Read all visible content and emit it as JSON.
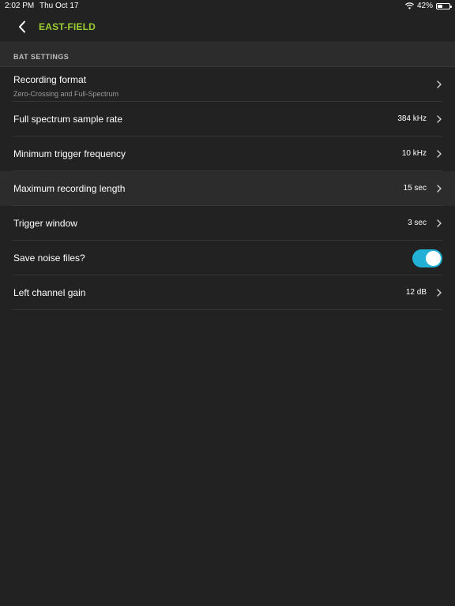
{
  "status_bar": {
    "time": "2:02 PM",
    "date": "Thu Oct 17",
    "battery_percent_label": "42%",
    "battery_level": 0.42,
    "wifi_icon": "wifi-icon",
    "battery_icon": "battery-icon"
  },
  "nav": {
    "title": "EAST-FIELD",
    "back_icon": "chevron-left-icon",
    "title_color": "#9acd32"
  },
  "section": {
    "header": "BAT SETTINGS"
  },
  "settings": [
    {
      "label": "Recording format",
      "sublabel": "Zero-Crossing and Full-Spectrum",
      "value": ""
    },
    {
      "label": "Full spectrum sample rate",
      "value": "384 kHz"
    },
    {
      "label": "Minimum trigger frequency",
      "value": "10 kHz"
    },
    {
      "label": "Maximum recording length",
      "value": "15 sec"
    },
    {
      "label": "Trigger window",
      "value": "3 sec"
    },
    {
      "label": "Save noise files?",
      "toggle_on": true
    },
    {
      "label": "Left channel gain",
      "value": "12 dB"
    }
  ],
  "colors": {
    "background": "#222222",
    "section_header_bg": "#2c2c2c",
    "toggle_on": "#22b0d6",
    "accent": "#9acd32"
  }
}
